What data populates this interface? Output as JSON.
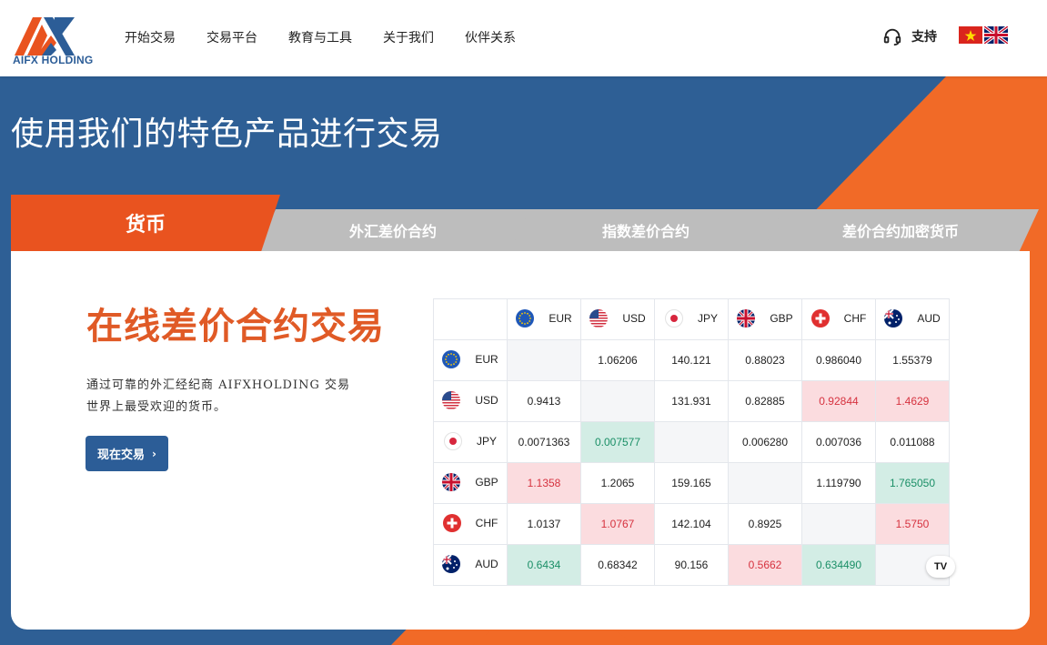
{
  "header": {
    "logo_text": "AIFX HOLDING",
    "nav": [
      "开始交易",
      "交易平台",
      "教育与工具",
      "关于我们",
      "伙伴关系"
    ],
    "support_label": "支持",
    "languages": [
      "vietnamese-flag-icon",
      "uk-flag-icon"
    ]
  },
  "hero": {
    "title": "使用我们的特色产品进行交易"
  },
  "tabs": {
    "active": "货币",
    "items": [
      "外汇差价合约",
      "指数差价合约",
      "差价合约加密货币"
    ]
  },
  "content": {
    "title": "在线差价合约交易",
    "description": "通过可靠的外汇经纪商 AIFXHOLDING 交易世界上最受欢迎的货币。",
    "cta_label": "现在交易",
    "cta_arrow": "›"
  },
  "matrix": {
    "currencies": [
      "EUR",
      "USD",
      "JPY",
      "GBP",
      "CHF",
      "AUD"
    ],
    "rows": [
      [
        "",
        "1.06206",
        "140.121",
        "0.88023",
        "0.986040",
        "1.55379"
      ],
      [
        "0.9413",
        "",
        "131.931",
        "0.82885",
        "0.92844",
        "1.4629"
      ],
      [
        "0.0071363",
        "0.007577",
        "",
        "0.006280",
        "0.007036",
        "0.011088"
      ],
      [
        "1.1358",
        "1.2065",
        "159.165",
        "",
        "1.119790",
        "1.765050"
      ],
      [
        "1.0137",
        "1.0767",
        "142.104",
        "0.8925",
        "",
        "1.5750"
      ],
      [
        "0.6434",
        "0.68342",
        "90.156",
        "0.5662",
        "0.634490",
        ""
      ]
    ],
    "states": [
      [
        "empty",
        "",
        "",
        "",
        "",
        ""
      ],
      [
        "",
        "empty",
        "",
        "",
        "red",
        "red"
      ],
      [
        "",
        "green",
        "empty",
        "",
        "",
        ""
      ],
      [
        "red",
        "",
        "",
        "empty",
        "",
        "green"
      ],
      [
        "",
        "red",
        "",
        "",
        "empty",
        "red"
      ],
      [
        "green",
        "",
        "",
        "red",
        "green",
        "empty"
      ]
    ],
    "badge": "TV"
  },
  "colors": {
    "brand_blue": "#2e5f95",
    "brand_orange": "#e9531f",
    "up_green": "#1b8f67",
    "down_red": "#d6323f"
  }
}
